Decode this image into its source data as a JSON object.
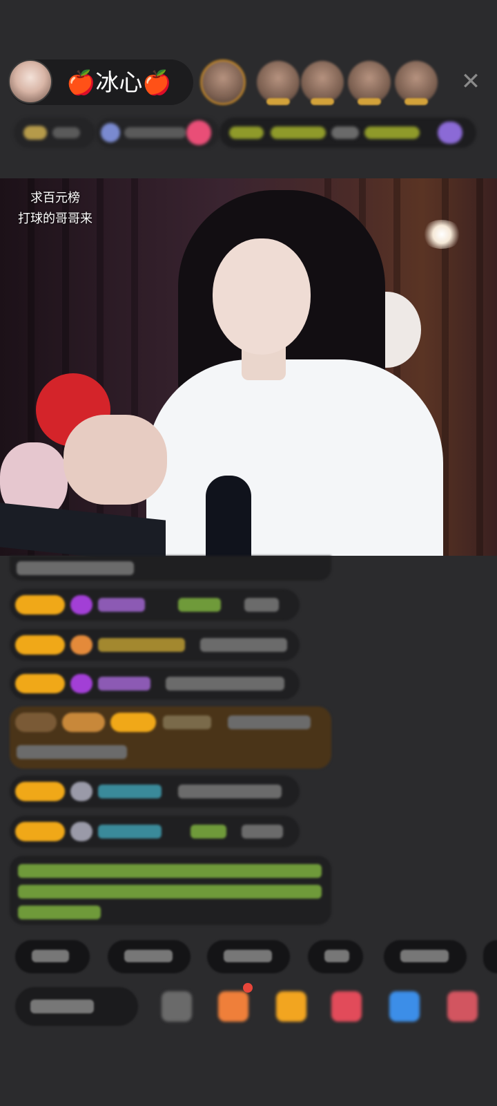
{
  "host": {
    "name": "🍎冰心🍎"
  },
  "video": {
    "caption_line1": "求百元榜",
    "caption_line2": "打球的哥哥来"
  },
  "close_icon": "✕",
  "colors": {
    "background": "#2b2b2d",
    "badge_gold": "#f0a818",
    "chat_bubble": "#1f1f21",
    "highlight_bubble": "#4a3418",
    "system_text_green": "#7db35a"
  },
  "icons": [
    "avatar",
    "viewer-avatar",
    "close-icon",
    "diamond-badge-icon",
    "gift-icon"
  ]
}
